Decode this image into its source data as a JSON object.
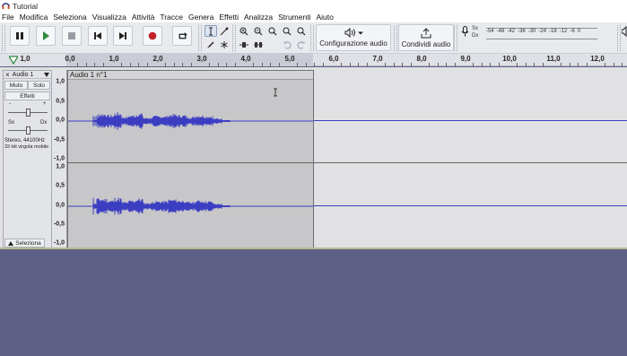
{
  "window": {
    "title": "Tutorial"
  },
  "menu": [
    "File",
    "Modifica",
    "Seleziona",
    "Visualizza",
    "Attività",
    "Tracce",
    "Genera",
    "Effetti",
    "Analizza",
    "Strumenti",
    "Aiuto"
  ],
  "toolbar": {
    "audio_setup_label": "Configurazione audio",
    "share_audio_label": "Condividi audio"
  },
  "meter": {
    "left_label": "Sx",
    "right_label": "Dx",
    "scale": [
      "-54",
      "-48",
      "-42",
      "-36",
      "-30",
      "-24",
      "-18",
      "-12",
      "-6",
      "0"
    ],
    "right_edge": "Sx\nDx"
  },
  "timeline": {
    "start": "1,0",
    "ticks": [
      "0,0",
      "1,0",
      "2,0",
      "3,0",
      "4,0",
      "5,0",
      "6,0",
      "7,0",
      "8,0",
      "9,0",
      "10,0",
      "11,0",
      "12,0"
    ]
  },
  "track": {
    "name": "Audio 1",
    "mute": "Muto",
    "solo": "Solo",
    "effects": "Effetti",
    "gain_minus": "-",
    "gain_plus": "+",
    "pan_left": "Sx",
    "pan_right": "Dx",
    "info_line1": "Stereo, 44100Hz",
    "info_line2": "32-bit virgola mobile",
    "select_label": "Seleziona",
    "clip_name": "Audio 1 n°1",
    "vruler_top": [
      "1,0",
      "0,5",
      "0,0",
      "-0,5",
      "-1,0"
    ],
    "vruler_bottom": [
      "1,0",
      "0,5",
      "0,0",
      "-0,5",
      "-1,0"
    ]
  },
  "colors": {
    "waveform": "#3c3ec2",
    "clip": "#c7c7c9",
    "background": "#5e6185",
    "toolbar": "#e8eaee"
  }
}
